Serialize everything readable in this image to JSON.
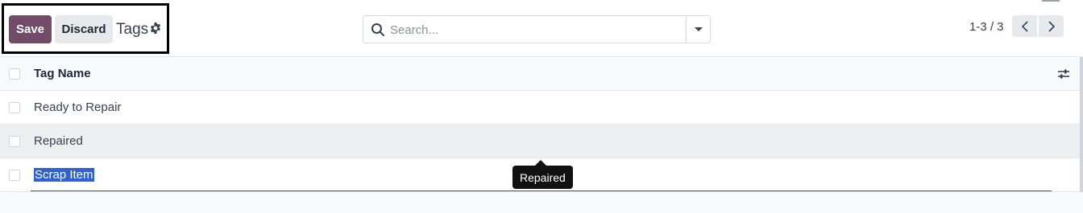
{
  "toolbar": {
    "save_label": "Save",
    "discard_label": "Discard",
    "breadcrumb": "Tags"
  },
  "search": {
    "placeholder": "Search...",
    "value": ""
  },
  "pager": {
    "value": "1-3 / 3"
  },
  "list": {
    "header": {
      "column": "Tag Name"
    },
    "rows": [
      {
        "name": "Ready to Repair"
      },
      {
        "name": "Repaired"
      },
      {
        "name": "Scrap Item"
      }
    ]
  },
  "tooltip": {
    "text": "Repaired"
  },
  "colors": {
    "primary": "#714b67",
    "selection": "#2d62d4"
  }
}
